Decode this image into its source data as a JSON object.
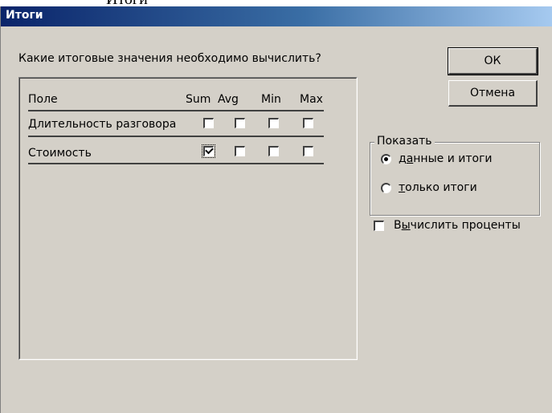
{
  "header_fragment": "Итоги",
  "dialog": {
    "title": "Итоги",
    "prompt": "Какие итоговые значения необходимо вычислить?",
    "columns": [
      "Поле",
      "Sum",
      "Avg",
      "Min",
      "Max"
    ],
    "rows": [
      {
        "field": "Длительность разговора",
        "sum": false,
        "avg": false,
        "min": false,
        "max": false
      },
      {
        "field": "Стоимость",
        "sum": true,
        "avg": false,
        "min": false,
        "max": false
      }
    ],
    "ok_label": "ОК",
    "cancel_label": "Отмена",
    "show_group": {
      "label": "Показать",
      "options": [
        {
          "pre": "д",
          "accel": "а",
          "post": "нные и итоги",
          "selected": true
        },
        {
          "pre": "",
          "accel": "т",
          "post": "олько итоги",
          "selected": false
        }
      ]
    },
    "percent_checkbox": {
      "pre": "В",
      "accel": "ы",
      "post": "числить проценты",
      "checked": false
    }
  },
  "colors": {
    "dialog_bg": "#d4d0c8",
    "title_start": "#0a246a",
    "title_end": "#a6caf0"
  }
}
